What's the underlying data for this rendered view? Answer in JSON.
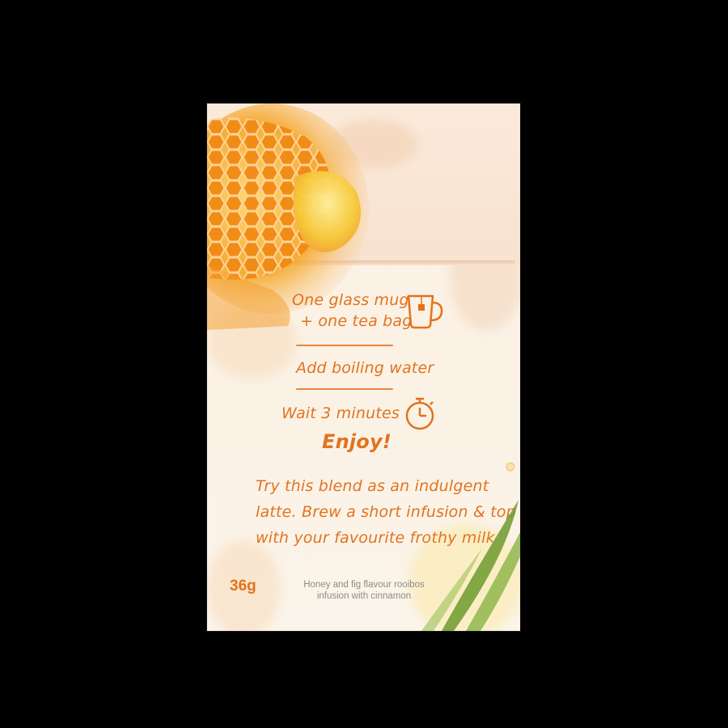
{
  "colors": {
    "background": "#000000",
    "accent": "#e2731f",
    "box": "#fdf6ee",
    "honey": "#f29a1e",
    "leaf": "#6c9a2e"
  },
  "instructions": {
    "step1_line1": "One glass mug",
    "step1_line2": "+ one tea bag",
    "step2": "Add boiling water",
    "step3": "Wait 3 minutes",
    "step4": "Enjoy!"
  },
  "latte_tip": {
    "line1": "Try this blend as an indulgent",
    "line2": "latte. Brew a short infusion & top",
    "line3": "with your favourite frothy milk"
  },
  "product": {
    "weight": "36g",
    "description_line1": "Honey and fig flavour rooibos",
    "description_line2": "infusion with cinnamon"
  },
  "icons": {
    "mug": "glass-mug-icon",
    "timer": "stopwatch-icon"
  }
}
